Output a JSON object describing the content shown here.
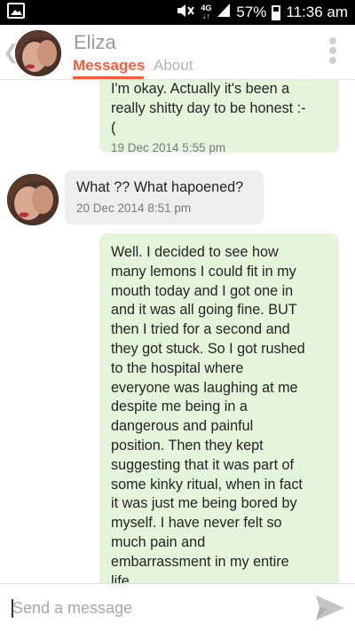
{
  "status_bar": {
    "network_top": "4G",
    "network_bottom": "↓↑",
    "battery": "57%",
    "time": "11:36 am"
  },
  "header": {
    "contact_name": "Eliza",
    "tabs": [
      {
        "label": "Messages",
        "active": true
      },
      {
        "label": "About",
        "active": false
      }
    ]
  },
  "messages": [
    {
      "direction": "outgoing",
      "text": "I'm okay. Actually it's been a\nreally shitty day to be honest :-\n(",
      "timestamp": "19 Dec 2014  5:55 pm"
    },
    {
      "direction": "incoming",
      "text": "What ?? What hapoened?",
      "timestamp": "20 Dec 2014  8:51 pm"
    },
    {
      "direction": "outgoing",
      "text": "Well. I decided to see how\nmany lemons I could fit in my\nmouth today and I got one in\nand it was all going fine. BUT\nthen I tried for a second and\nthey got stuck. So I got rushed\nto the hospital where\neveryone was laughing at me\ndespite me being in a\ndangerous and painful\nposition. Then they kept\nsuggesting that it was part of\nsome kinky ritual, when in fact\nit was just me being bored by\nmyself. I have never felt so\nmuch pain and\nembarrassment in my entire\nlife."
    }
  ],
  "compose": {
    "placeholder": "Send a message"
  },
  "colors": {
    "accent": "#ff5b3a",
    "outgoing_bubble": "#e5f5dc",
    "incoming_bubble": "#eeeeee"
  }
}
